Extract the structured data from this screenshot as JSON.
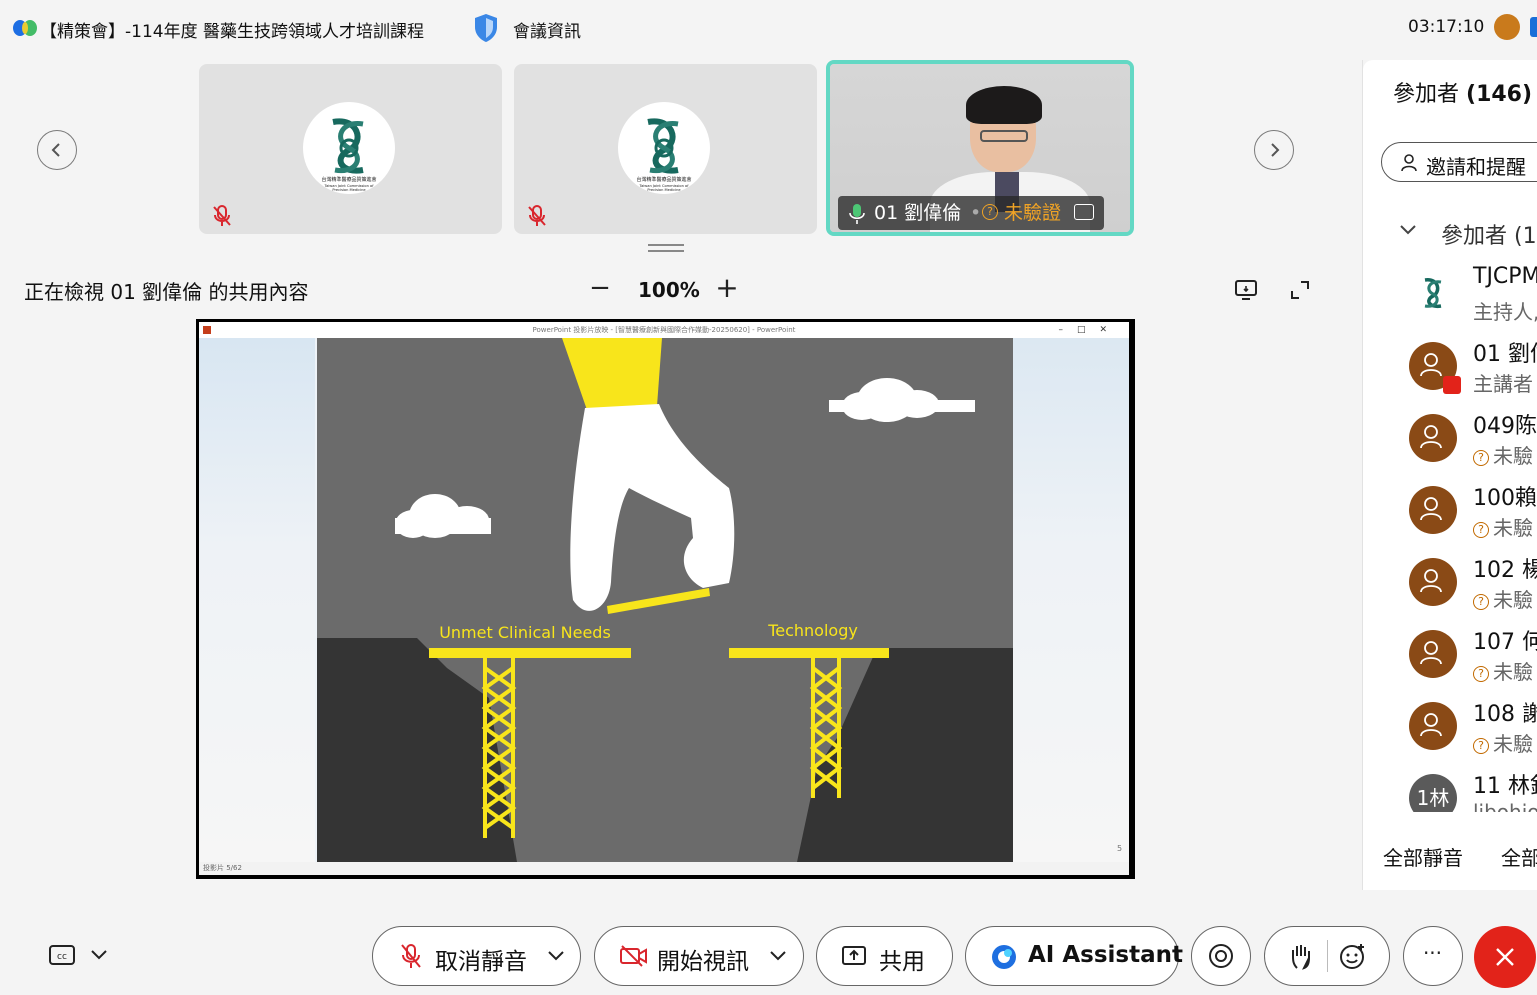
{
  "header": {
    "title": "【精策會】-114年度 醫藥生技跨領域人才培訓課程",
    "meeting_info": "會議資訊",
    "clock": "03:17:10"
  },
  "video_strip": {
    "tiles": [
      {
        "kind": "logo",
        "muted": true
      },
      {
        "kind": "logo",
        "muted": true
      },
      {
        "kind": "video",
        "name": "01 劉偉倫",
        "status": "未驗證",
        "muted": false,
        "speaking": true
      }
    ],
    "logo_text": {
      "line1": "台灣精準醫療品質策進會",
      "line2": "Taiwan Joint Commission of",
      "line3": "Precision Medicine"
    }
  },
  "share_bar": {
    "viewing_text": "正在檢視 01 劉偉倫 的共用內容",
    "zoom_minus": "−",
    "zoom": "100%",
    "zoom_plus": "+"
  },
  "powerpoint": {
    "window_title": "PowerPoint 投影片放映 - [智慧醫療創新與國際合作媒動-20250620] - PowerPoint",
    "status_left": "投影片 5/62",
    "slide_number": "5",
    "labels": {
      "left": "Unmet Clinical Needs",
      "right": "Technology"
    },
    "colors": {
      "slide_bg": "#6b6b6b",
      "yellow": "#f8e51b",
      "cliff": "#343434"
    }
  },
  "participants_panel": {
    "title": "參加者",
    "count": "(146)",
    "invite_label": "邀請和提醒",
    "section_label": "參加者 (1",
    "items": [
      {
        "name": "TJCPM",
        "sub": "主持人,",
        "avatar": "logo"
      },
      {
        "name": "01 劉偉",
        "sub": "主講者",
        "avatar": "user",
        "sharing": true
      },
      {
        "name": "049陈",
        "sub": "未驗",
        "avatar": "user",
        "unverified": true
      },
      {
        "name": "100賴",
        "sub": "未驗",
        "avatar": "user",
        "unverified": true
      },
      {
        "name": "102 楊",
        "sub": "未驗",
        "avatar": "user",
        "unverified": true
      },
      {
        "name": "107 何",
        "sub": "未驗",
        "avatar": "user",
        "unverified": true
      },
      {
        "name": "108 謝",
        "sub": "未驗",
        "avatar": "user",
        "unverified": true
      },
      {
        "name": "11 林釒",
        "sub": "libohio",
        "avatar": "initials",
        "initials": "1林"
      }
    ],
    "mute_all": "全部靜音",
    "mute_all_2": "全部"
  },
  "controls": {
    "unmute_label": "取消靜音",
    "video_label": "開始視訊",
    "share_label": "共用",
    "ai_label": "AI Assistant",
    "more_label": "···",
    "accent_red": "#e2231a"
  }
}
